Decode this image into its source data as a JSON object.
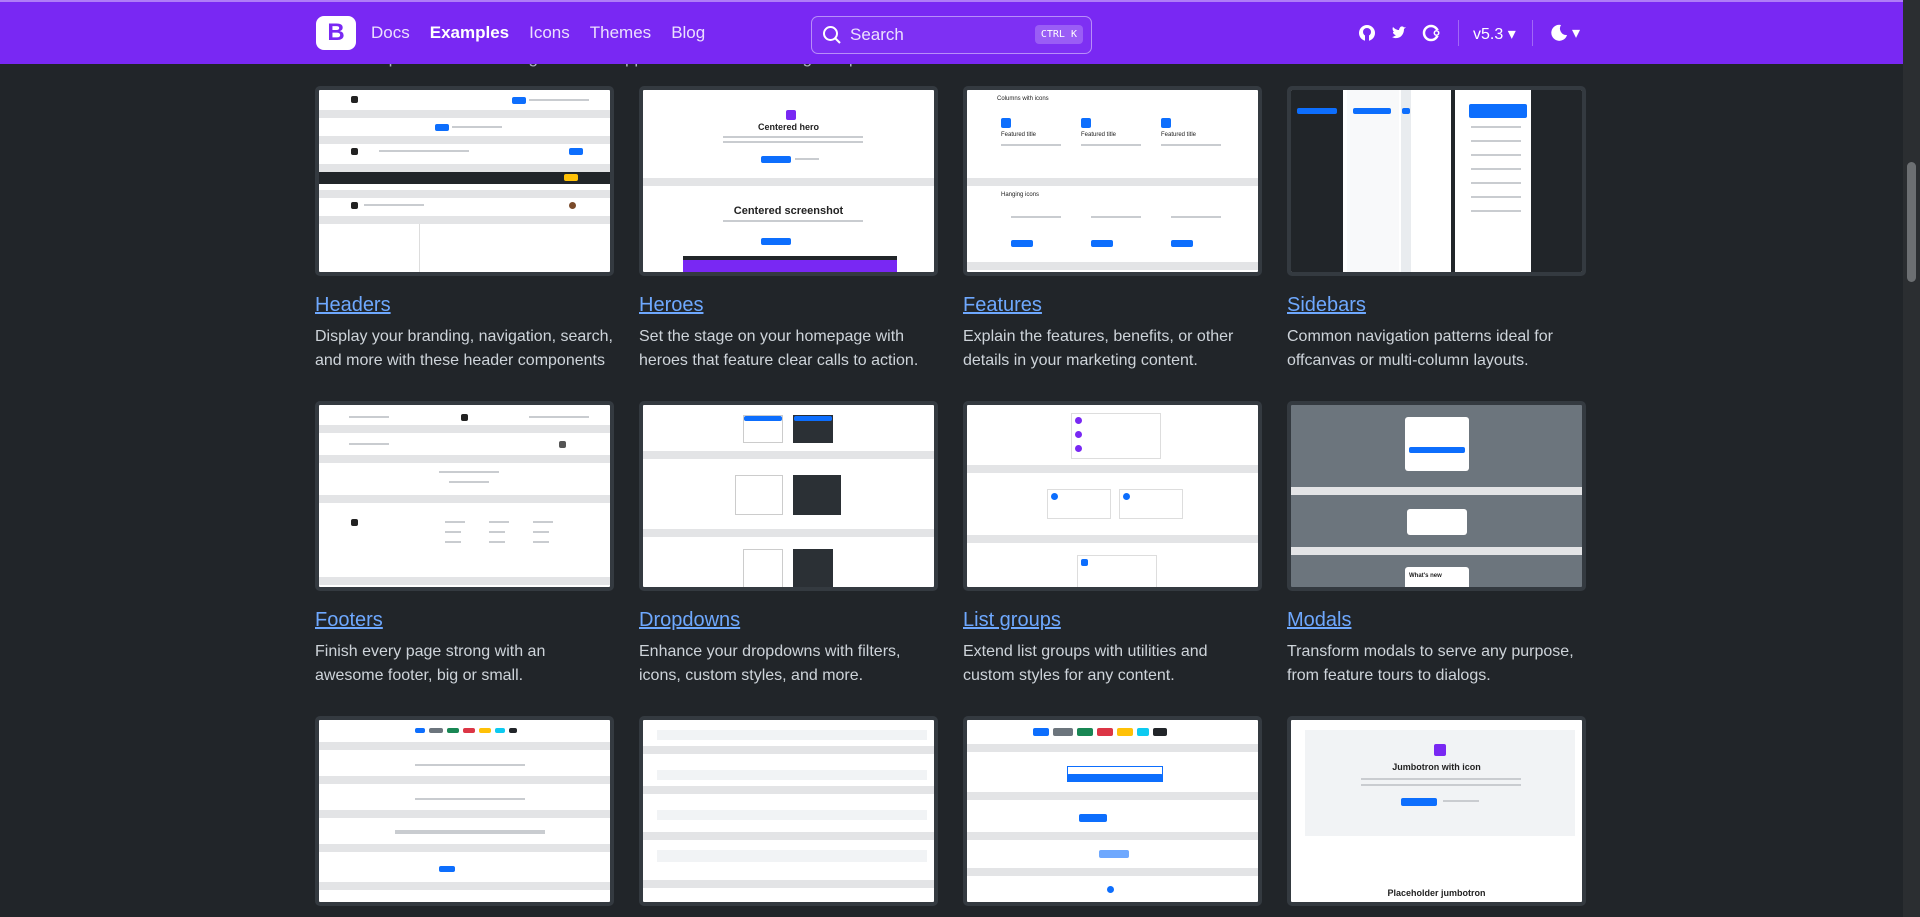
{
  "navbar": {
    "brand": "B",
    "links": [
      {
        "label": "Docs",
        "active": false
      },
      {
        "label": "Examples",
        "active": true
      },
      {
        "label": "Icons",
        "active": false
      },
      {
        "label": "Themes",
        "active": false
      },
      {
        "label": "Blog",
        "active": false
      }
    ],
    "search": {
      "placeholder": "Search",
      "shortcut": "CTRL K"
    },
    "version": "v5.3",
    "accent": "#7928f3"
  },
  "intro": "Common patterns for building sites and apps that build on existing components and utilities with custom CSS and more.",
  "cards": [
    {
      "title": "Headers",
      "desc": "Display your branding, navigation, search, and more with these header components"
    },
    {
      "title": "Heroes",
      "desc": "Set the stage on your homepage with heroes that feature clear calls to action.",
      "thumb_text": [
        "Centered hero",
        "Centered screenshot"
      ]
    },
    {
      "title": "Features",
      "desc": "Explain the features, benefits, or other details in your marketing content.",
      "thumb_text": [
        "Columns with icons",
        "Featured title",
        "Hanging icons"
      ]
    },
    {
      "title": "Sidebars",
      "desc": "Common navigation patterns ideal for offcanvas or multi-column layouts."
    },
    {
      "title": "Footers",
      "desc": "Finish every page strong with an awesome footer, big or small."
    },
    {
      "title": "Dropdowns",
      "desc": "Enhance your dropdowns with filters, icons, custom styles, and more."
    },
    {
      "title": "List groups",
      "desc": "Extend list groups with utilities and custom styles for any content."
    },
    {
      "title": "Modals",
      "desc": "Transform modals to serve any purpose, from feature tours to dialogs.",
      "thumb_text": [
        "What's new"
      ]
    },
    {
      "title": "",
      "desc": ""
    },
    {
      "title": "",
      "desc": ""
    },
    {
      "title": "",
      "desc": ""
    },
    {
      "title": "",
      "desc": "",
      "thumb_text": [
        "Jumbotron with icon",
        "Placeholder jumbotron"
      ]
    }
  ]
}
